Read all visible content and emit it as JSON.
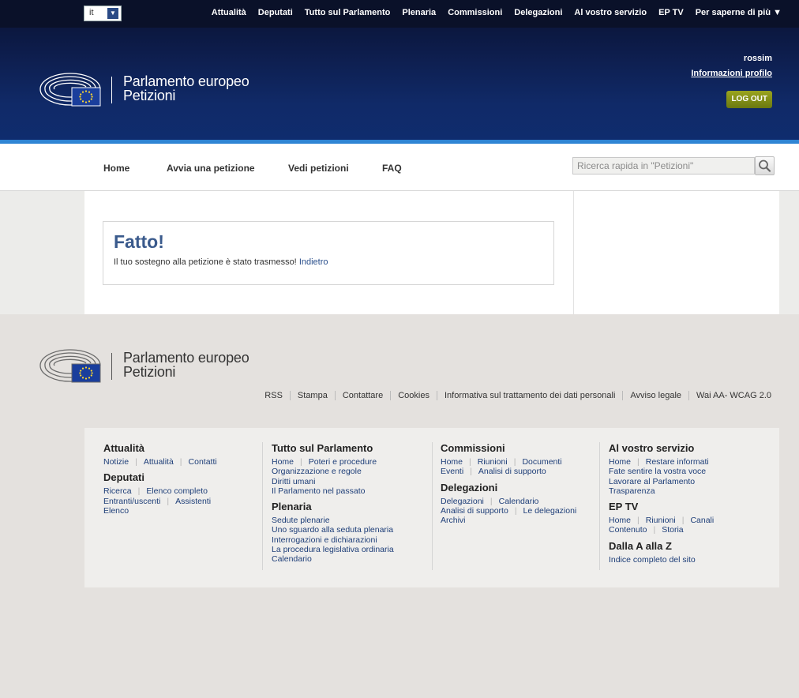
{
  "header": {
    "language": "it",
    "top_nav": [
      "Attualità",
      "Deputati",
      "Tutto sul Parlamento",
      "Plenaria",
      "Commissioni",
      "Delegazioni",
      "Al vostro servizio",
      "EP TV",
      "Per saperne di più ▼"
    ],
    "brand_line1": "Parlamento europeo",
    "brand_line2": "Petizioni",
    "user_name": "rossim",
    "profile_link": "Informazioni profilo",
    "logout": "LOG OUT"
  },
  "main_nav": {
    "items": [
      "Home",
      "Avvia una petizione",
      "Vedi petizioni",
      "FAQ"
    ],
    "search_placeholder": "Ricerca rapida in \"Petizioni\""
  },
  "message": {
    "title": "Fatto!",
    "text": "Il tuo sostegno alla petizione è stato trasmesso!",
    "back_link": "Indietro"
  },
  "footer": {
    "brand_line1": "Parlamento europeo",
    "brand_line2": "Petizioni",
    "links": [
      "RSS",
      "Stampa",
      "Contattare",
      "Cookies",
      "Informativa sul trattamento dei dati personali",
      "Avviso legale",
      "Wai AA- WCAG 2.0"
    ],
    "sitemap": {
      "col1": {
        "h1": "Attualità",
        "h1_links": [
          "Notizie",
          "Attualità",
          "Contatti"
        ],
        "h2": "Deputati",
        "h2_links": [
          "Ricerca",
          "Elenco completo",
          "Entranti/uscenti",
          "Assistenti",
          "Elenco"
        ]
      },
      "col2": {
        "h1": "Tutto sul Parlamento",
        "h1_links": [
          "Home",
          "Poteri e procedure",
          "Organizzazione e regole",
          "Diritti umani",
          "Il Parlamento nel passato"
        ],
        "h2": "Plenaria",
        "h2_links": [
          "Sedute plenarie",
          "Uno sguardo alla seduta plenaria",
          "Interrogazioni e dichiarazioni",
          "La procedura legislativa ordinaria",
          "Calendario"
        ]
      },
      "col3": {
        "h1": "Commissioni",
        "h1_links": [
          "Home",
          "Riunioni",
          "Documenti",
          "Eventi",
          "Analisi di supporto"
        ],
        "h2": "Delegazioni",
        "h2_links": [
          "Delegazioni",
          "Calendario",
          "Analisi di supporto",
          "Le delegazioni",
          "Archivi"
        ]
      },
      "col4": {
        "h1": "Al vostro servizio",
        "h1_links": [
          "Home",
          "Restare informati",
          "Fate sentire la vostra voce",
          "Lavorare al Parlamento",
          "Trasparenza"
        ],
        "h2": "EP TV",
        "h2_links": [
          "Home",
          "Riunioni",
          "Canali",
          "Contenuto",
          "Storia"
        ],
        "h3": "Dalla A alla Z",
        "h3_links": [
          "Indice completo del sito"
        ]
      }
    }
  },
  "colors": {
    "header_dark": "#0a1230",
    "header_stripe": "#2f85d4",
    "logout_green": "#7d8a14",
    "title_blue": "#3a5a8c",
    "link_blue": "#1e3e78"
  }
}
